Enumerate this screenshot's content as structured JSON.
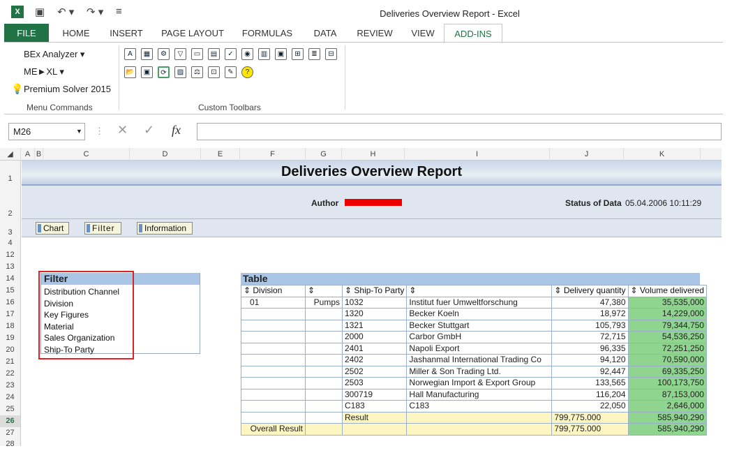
{
  "window": {
    "title": "Deliveries Overview Report - Excel"
  },
  "tabs": [
    "FILE",
    "HOME",
    "INSERT",
    "PAGE LAYOUT",
    "FORMULAS",
    "DATA",
    "REVIEW",
    "VIEW",
    "ADD-INS"
  ],
  "ribbon": {
    "menu_commands": [
      "BEx Analyzer ▾",
      "ME►XL ▾",
      "Premium Solver 2015"
    ],
    "group_menu_label": "Menu Commands",
    "group_toolbar_label": "Custom Toolbars"
  },
  "formula_bar": {
    "name_box": "M26",
    "value": ""
  },
  "columns": [
    "A",
    "B",
    "C",
    "D",
    "E",
    "F",
    "G",
    "H",
    "I",
    "J",
    "K"
  ],
  "rows": [
    "1",
    "2",
    "3",
    "4",
    "12",
    "13",
    "14",
    "15",
    "16",
    "17",
    "18",
    "19",
    "20",
    "21",
    "22",
    "23",
    "24",
    "25",
    "26",
    "27",
    "28"
  ],
  "report": {
    "title": "Deliveries Overview Report",
    "author_label": "Author",
    "status_label": "Status of Data",
    "status_value": "05.04.2006 10:11:29",
    "buttons": [
      "Chart",
      "Filter",
      "Information"
    ]
  },
  "filter": {
    "title": "Filter",
    "items": [
      "Distribution Channel",
      "Division",
      "Key Figures",
      "Material",
      "Sales Organization",
      "Ship-To Party"
    ]
  },
  "table": {
    "title": "Table",
    "headers": [
      "Division",
      "",
      "Ship-To Party",
      "",
      "Delivery quantity",
      "Volume delivered"
    ],
    "rows": [
      [
        "01",
        "Pumps",
        "1032",
        "Institut fuer Umweltforschung",
        "47,380",
        "35,535,000"
      ],
      [
        "",
        "",
        "1320",
        "Becker Koeln",
        "18,972",
        "14,229,000"
      ],
      [
        "",
        "",
        "1321",
        "Becker Stuttgart",
        "105,793",
        "79,344,750"
      ],
      [
        "",
        "",
        "2000",
        "Carbor GmbH",
        "72,715",
        "54,536,250"
      ],
      [
        "",
        "",
        "2401",
        "Napoli Export",
        "96,335",
        "72,251,250"
      ],
      [
        "",
        "",
        "2402",
        "Jashanmal International Trading Co",
        "94,120",
        "70,590,000"
      ],
      [
        "",
        "",
        "2502",
        "Miller & Son Trading Ltd.",
        "92,447",
        "69,335,250"
      ],
      [
        "",
        "",
        "2503",
        "Norwegian Import & Export Group",
        "133,565",
        "100,173,750"
      ],
      [
        "",
        "",
        "300719",
        "Hall Manufacturing",
        "116,204",
        "87,153,000"
      ],
      [
        "",
        "",
        "C183",
        "C183",
        "22,050",
        "2,646,000"
      ]
    ],
    "result_row": [
      "",
      "",
      "Result",
      "",
      "799,775.000",
      "585,940,290"
    ],
    "overall_row": [
      "Overall Result",
      "",
      "",
      "",
      "799,775.000",
      "585,940,290"
    ]
  }
}
